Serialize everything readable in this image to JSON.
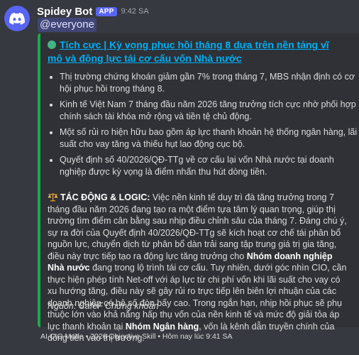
{
  "bot": {
    "name": "Spidey Bot",
    "badge": "APP",
    "time": "9:42 SA"
  },
  "mention": "@everyone",
  "embed": {
    "accent_color": "#1aa84a",
    "title_icon": "green-circle-icon",
    "title": "Tích cực | Kỳ vọng phục hồi tháng 8 dựa trên nền tảng vĩ mô và động lực tái cơ cấu vốn Nhà nước",
    "bullets": [
      "Thị trường chứng khoán giảm gần 7% trong tháng 7, MBS nhận định có cơ hội phục hồi trong tháng 8.",
      "Kinh tế Việt Nam 7 tháng đầu năm 2026 tăng trưởng tích cực nhờ phối hợp chính sách tài khóa mở rộng và tiền tệ chủ động.",
      "Một số rủi ro hiện hữu bao gồm áp lực thanh khoản hệ thống ngân hàng, lãi suất cho vay tăng và thiếu hụt lao động cục bộ.",
      "Quyết định số 40/2026/QĐ-TTg về cơ cấu lại vốn Nhà nước tại doanh nghiệp được kỳ vọng là điểm nhấn thu hút dòng tiền."
    ],
    "impact": {
      "icon": "scales-icon",
      "heading": "TÁC ĐỘNG & LOGIC:",
      "text1": " Việc nền kinh tế duy trì đà tăng trưởng trong 7 tháng đầu năm 2026 đang tạo ra một điểm tựa tâm lý quan trọng, giúp thị trường tìm điểm cân bằng sau nhịp điều chỉnh sâu của tháng 7. Đáng chú ý, sự ra đời của Quyết định 40/2026/QĐ-TTg sẽ kích hoạt cơ chế tái phân bổ nguồn lực, chuyển dịch từ phân bổ dàn trải sang tập trung giá trị gia tăng, điều này trực tiếp tạo ra động lực tăng trưởng cho ",
      "bold1": "Nhóm doanh nghiệp Nhà nước",
      "text2": " đang trong lộ trình tái cơ cấu. Tuy nhiên, dưới góc nhìn CIO, cần thực hiện phép tính Net-off với áp lực từ chi phí vốn khi lãi suất cho vay có xu hướng tăng, điều này sẽ gây rủi ro trực tiếp lên biên lợi nhuận của các doanh nghiệp có hệ số đòn bẩy cao. Trong ngắn hạn, nhịp hồi phục sẽ phụ thuộc lớn vào khả năng hấp thụ vốn của nền kinh tế và mức độ giải tỏa áp lực thanh khoản tại ",
      "bold2": "Nhóm Ngân hàng",
      "text3": ", vốn là kênh dẫn truyền chính của dòng tiền vào thị trường."
    },
    "source": "Nguồn: CafeF Chứng khoán"
  },
  "footer": "AI CIO Mode • 2026 Objective Skill • Hôm nay lúc 9:41 SA"
}
